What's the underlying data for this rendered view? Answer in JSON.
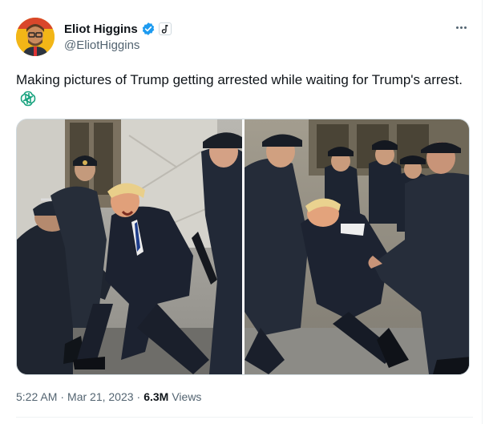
{
  "author": {
    "display_name": "Eliot Higgins",
    "handle": "@EliotHiggins",
    "verified": true,
    "verified_color": "#1d9bf0",
    "affiliation_icon": "affiliation-badge-icon",
    "avatar_icon": "avatar-portrait"
  },
  "tweet": {
    "text": "Making pictures of Trump getting arrested while waiting for Trump's arrest.",
    "emoji_icon": "chatgpt-logo-icon"
  },
  "media": {
    "count": 2,
    "images": [
      "photo-left",
      "photo-right"
    ]
  },
  "meta": {
    "time": "5:22 AM",
    "date": "Mar 21, 2023",
    "views_count": "6.3M",
    "views_label": "Views"
  },
  "colors": {
    "text_primary": "#0f1419",
    "text_secondary": "#536471",
    "border": "#cfd9de",
    "accent": "#1d9bf0"
  }
}
